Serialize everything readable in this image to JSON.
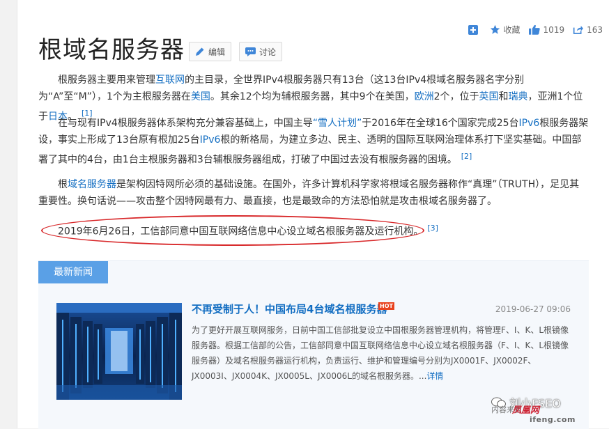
{
  "actions": {
    "collect_label": "收藏",
    "like_count": "1019",
    "share_count": "163"
  },
  "title": "根域名服务器",
  "buttons": {
    "edit": "编辑",
    "discuss": "讨论"
  },
  "para1": {
    "t1": "根服务器主要用来管理",
    "l1": "互联网",
    "t2": "的主目录，全世界IPv4根服务器只有13台（这13台IPv4根域名服务器名字分别为“A”至“M”），1个为主根服务器在",
    "l2": "美国",
    "t3": "。其余12个均为辅根服务器，其中9个在美国，",
    "l3": "欧洲",
    "t4": "2个，位于",
    "l4": "英国",
    "t5": "和",
    "l5": "瑞典",
    "t6": "，亚洲1个位于",
    "l6": "日本",
    "t7": "。",
    "ref": "[1]"
  },
  "para2": {
    "t1": "在与现有IPv4根服务器体系架构充分兼容基础上，中国主导",
    "l1": "“雪人计划”",
    "t2": "于2016年在全球16个国家完成25台",
    "l2": "IPv6",
    "t3": "根服务器架设，事实上形成了13台原有根加25台",
    "l3": "IPv6",
    "t4": "根的新格局，为建立多边、民主、透明的国际互联网治理体系打下坚实基础。中国部署了其中的4台，由1台主根服务器和3台辅根服务器组成，打破了中国过去没有根服务器的困境。",
    "ref": "[2]"
  },
  "para3": {
    "t1": "根",
    "l1": "域名服务器",
    "t2": "是架构因特网所必须的基础设施。在国外，许多计算机科学家将根域名服务器称作“真理”（TRUTH），足见其重要性。换句话说——攻击整个因特网最有力、最直接，也是最致命的方法恐怕就是攻击根域名服务器了。"
  },
  "para4": {
    "text": "2019年6月26日，工信部同意中国互联网络信息中心设立域名根服务器及运行机构。",
    "ref": "[3]"
  },
  "news": {
    "tab": "最新新闻",
    "title": "不再受制于人！中国布局4台域名根服务器",
    "badge": "HOT",
    "date": "2019-06-27 09:06",
    "body": "为了更好开展互联网服务，日前中国工信部批复设立中国根服务器管理机构，将管理F、I、K、L根镜像服务器。根据工信部的公告，工信部同意中国互联网络信息中心设立域名根服务器（F、I、K、L根镜像服务器）及域名根服务器运行机构，负责运行、维护和管理编号分别为JX0001F、JX0002F、JX0003I、JX0004K、JX0005L、JX0006L的域名根服务器。...",
    "more": "详情"
  },
  "watermarks": {
    "wechat": "刘小FSEO",
    "source": "内容来自",
    "ifeng_logo": "凤凰网",
    "ifeng_domain": "ifeng.com"
  },
  "colors": {
    "link": "#136ec2",
    "tab": "#5aa0e6",
    "highlight": "#d8282a"
  }
}
